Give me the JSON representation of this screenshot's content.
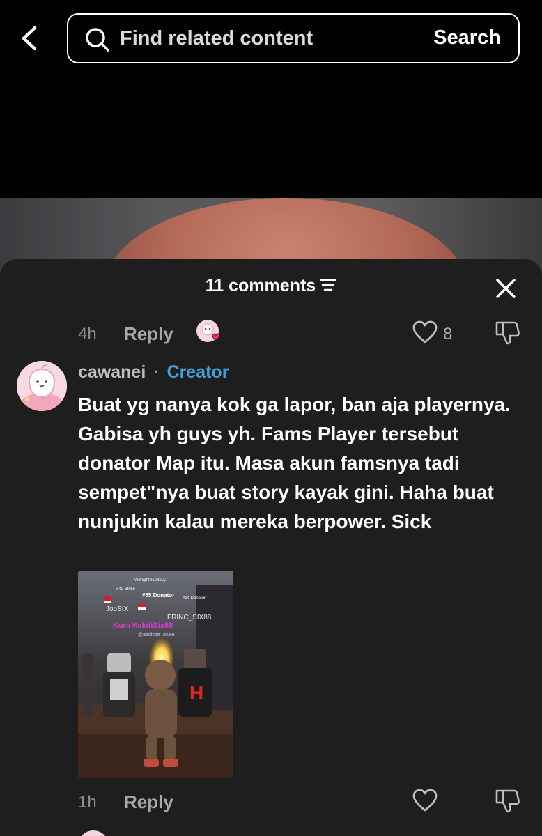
{
  "search": {
    "placeholder": "Find related content",
    "button_label": "Search"
  },
  "comments_panel": {
    "title": "11 comments"
  },
  "previous_comment": {
    "time": "4h",
    "reply_label": "Reply",
    "like_count": "8"
  },
  "comment": {
    "author": "cawanei",
    "separator": "·",
    "badge": "Creator",
    "text": "Buat yg nanya kok ga lapor, ban aja playernya. Gabisa yh guys yh. Fams Player tersebut donator Map itu. Masa akun famsnya tadi sempet\"nya buat story kayak gini. Haha buat nunjukin kalau mereka berpower. Sick",
    "time": "1h",
    "reply_label": "Reply",
    "image_labels": {
      "top_tag": "Midnight Fantasy",
      "rank_a": "#42 Strike",
      "rank_b": "#55 Donator",
      "rank_c": "#14 Donator",
      "name_left": "JooSIX",
      "name_right": "FRINC_SIX88",
      "name_pink": "KurirMekdiSix88",
      "handle": "@addicctt_30.66",
      "shirt": "H"
    }
  },
  "colors": {
    "sheet_bg": "#1e1e1e",
    "creator_badge": "#3fa2d8",
    "meta_text": "#8f8f8f",
    "like_heart_red": "#ff2d55"
  },
  "icons": {
    "back": "chevron-left-icon",
    "search": "magnifier-icon",
    "sort": "sort-lines-icon",
    "close": "close-icon",
    "like": "heart-outline-icon",
    "dislike": "thumbs-down-icon"
  }
}
